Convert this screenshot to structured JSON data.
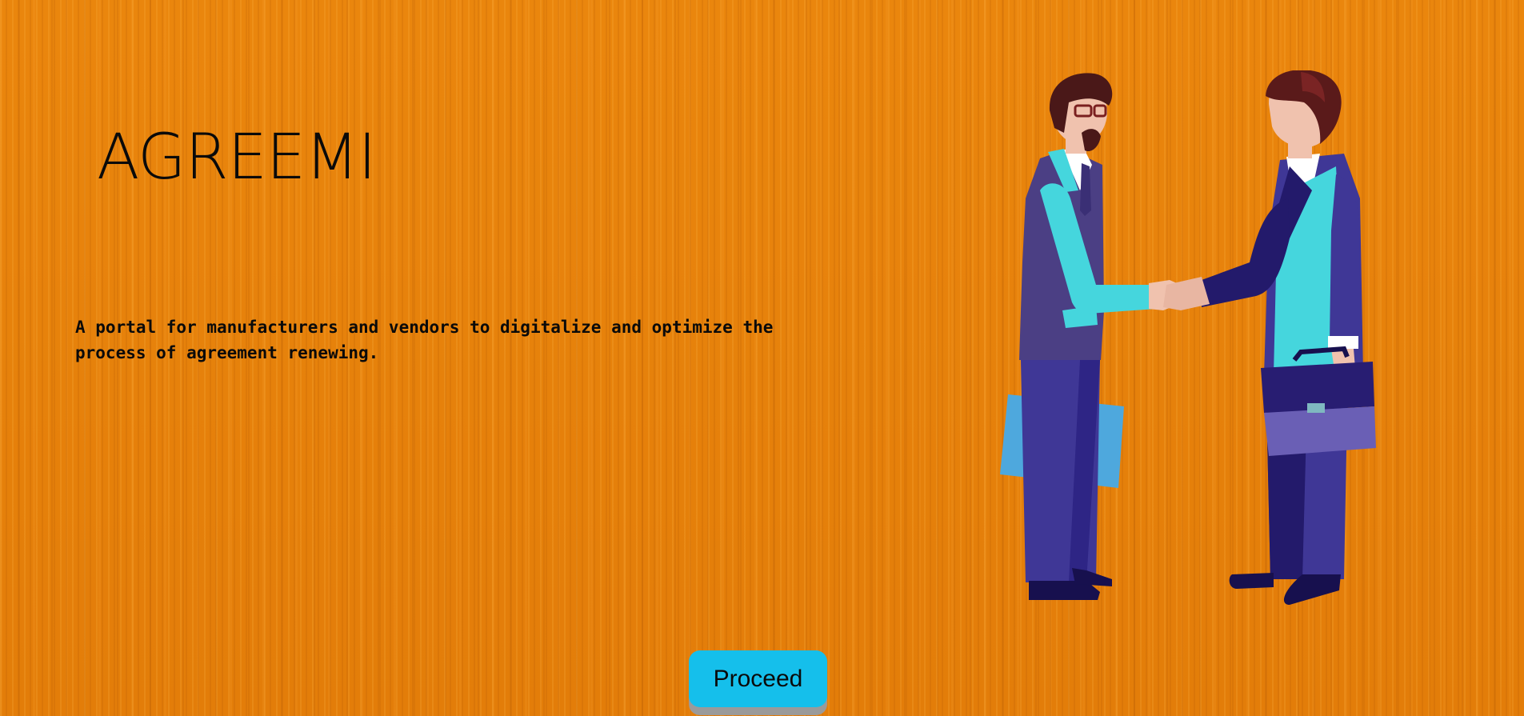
{
  "app": {
    "title": "AGREEMI",
    "tagline": "A portal for manufacturers and vendors to digitalize and optimize the process of agreement renewing."
  },
  "illustration": {
    "icon": "handshake-businessmen-illustration",
    "colors": {
      "suit_dark": "#3f3796",
      "suit_navy": "#231a6b",
      "shirt_cyan": "#45d6dd",
      "skin": "#f0c2ae",
      "hair": "#4a1818",
      "folder_blue": "#4ea8dd",
      "briefcase_top": "#281d72",
      "briefcase_bottom": "#6a5fb5"
    }
  },
  "actions": {
    "proceed_label": "Proceed"
  },
  "theme": {
    "background": "#e8820a",
    "button_color": "#15bfeb",
    "text_color": "#0a0a0a"
  }
}
